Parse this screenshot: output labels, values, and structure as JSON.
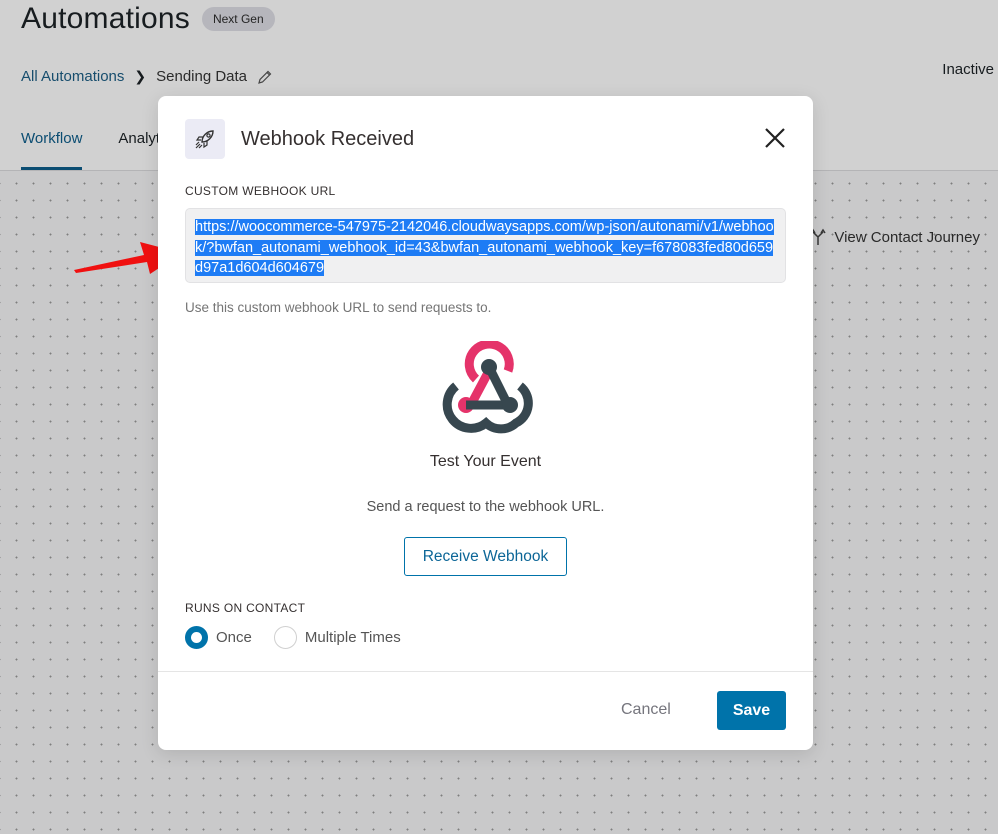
{
  "page": {
    "title": "Automations",
    "badge": "Next Gen",
    "breadcrumb": {
      "parent": "All Automations",
      "current": "Sending Data"
    },
    "status": "Inactive",
    "tabs": [
      {
        "label": "Workflow",
        "active": true
      },
      {
        "label": "Analytics",
        "active": false
      }
    ],
    "journey_link": "View Contact Journey"
  },
  "modal": {
    "title": "Webhook Received",
    "url_label": "Custom Webhook URL",
    "url_value": "https://woocommerce-547975-2142046.cloudwaysapps.com/wp-json/autonami/v1/webhook/?bwfan_autonami_webhook_id=43&bwfan_autonami_webhook_key=f678083fed80d659d97a1d604d604679",
    "url_help": "Use this custom webhook URL to send requests to.",
    "test_title": "Test Your Event",
    "test_description": "Send a request to the webhook URL.",
    "receive_button": "Receive Webhook",
    "runs_label": "Runs on Contact",
    "runs_options": [
      {
        "label": "Once",
        "selected": true
      },
      {
        "label": "Multiple Times",
        "selected": false
      }
    ],
    "cancel_button": "Cancel",
    "save_button": "Save"
  },
  "colors": {
    "primary": "#0073aa",
    "selection": "#1e7cf5",
    "webhook_pink": "#e5336a",
    "webhook_dark": "#37474f",
    "annotation_arrow": "#f01010"
  }
}
